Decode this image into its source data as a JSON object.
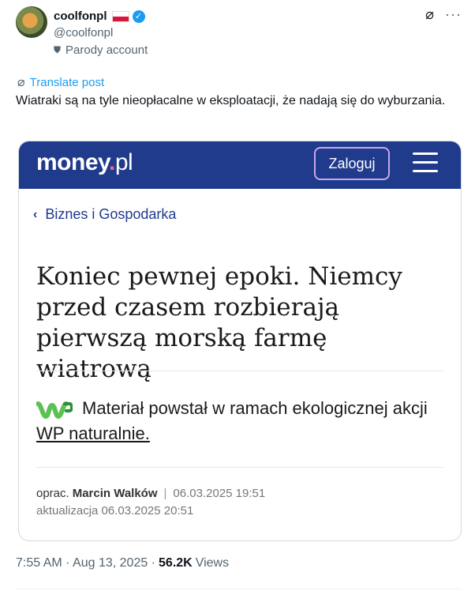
{
  "post": {
    "display_name": "coolfonpl",
    "handle": "@coolfonpl",
    "parody_label": "Parody account",
    "translate_label": "Translate post",
    "text": "Wiatraki są na tyle nieopłacalne w eksploatacji, że nadają się do wyburzania.",
    "timestamp": "7:55 AM · Aug 13, 2025 ·",
    "views_count": "56.2K",
    "views_label": "Views"
  },
  "card": {
    "logo_main": "money",
    "logo_dot": ".",
    "logo_tld": "pl",
    "login_label": "Zaloguj",
    "breadcrumb": "Biznes i Gospodarka",
    "headline": "Koniec pewnej epoki. Niemcy przed czasem rozbierają pierwszą morską farmę wiatrową",
    "note_text": "Materiał powstał w ramach ekologicznej akcji ",
    "note_link": "WP naturalnie.",
    "byline_prefix": "oprac.",
    "author": "Marcin Walków",
    "pipe": "|",
    "published": "06.03.2025 19:51",
    "updated": "aktualizacja 06.03.2025 20:51"
  },
  "icons": {
    "verified": "verified-badge",
    "flag": "poland-flag",
    "grok": "grok-icon",
    "more": "more-icon",
    "translate": "translate-icon",
    "menu": "hamburger-menu-icon",
    "back": "chevron-left-icon",
    "wp": "wp-logo"
  },
  "colors": {
    "accent": "#1d9bf0",
    "site_bar": "#203a8c",
    "login_border": "#c9a8e8",
    "wp_green": "#5cc153"
  }
}
